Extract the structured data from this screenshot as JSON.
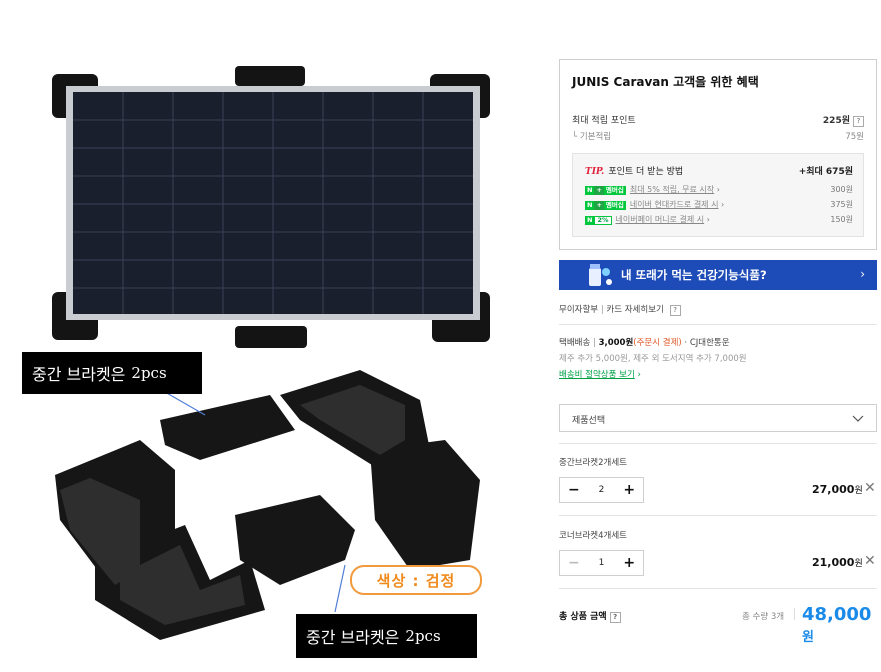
{
  "image": {
    "callout_top": {
      "text": "중간 브라켓은",
      "pcs": "2pcs"
    },
    "callout_bottom": {
      "text": "중간 브라켓은",
      "pcs": "2pcs"
    },
    "color_tag": "색상 : 검정"
  },
  "benefit": {
    "title": "JUNIS Caravan 고객을 위한 혜택",
    "max_points_label": "최대 적립 포인트",
    "max_points_value": "225원",
    "basic_label": "기본적립",
    "basic_value": "75원",
    "tip_word": "TIP.",
    "tip_label": "포인트 더 받는 방법",
    "tip_max": "+최대 675원",
    "tip_items": [
      {
        "badge": "멤버십",
        "label": "최대 5% 적립, 무료 시작",
        "value": "300원"
      },
      {
        "badge": "멤버십",
        "label": "네이버 현대카드로 결제 시",
        "value": "375원"
      },
      {
        "badge": "2%",
        "label": "네이버페이 머니로 결제 시",
        "value": "150원"
      }
    ]
  },
  "banner": {
    "text": "내 또래가 먹는 건강기능식품?",
    "arrow": "›"
  },
  "payment": {
    "installment": "무이자할부",
    "card_details": "카드 자세히보기"
  },
  "shipping": {
    "method": "택배배송",
    "fee": "3,000원",
    "fee_note": "(주문시 결제)",
    "carrier": "· CJ대한통운",
    "extra": "제주 추가 5,000원, 제주 외 도서지역 추가 7,000원",
    "bundle_link": "배송비 절약상품 보기"
  },
  "select": {
    "placeholder": "제품선택"
  },
  "options": [
    {
      "name": "중간브라켓2개세트",
      "qty": "2",
      "price": "27,000",
      "unit": "원"
    },
    {
      "name": "코너브라켓4개세트",
      "qty": "1",
      "price": "21,000",
      "unit": "원"
    }
  ],
  "total": {
    "label": "총 상품 금액",
    "qty_text": "총 수량 3개",
    "amount": "48,000",
    "unit": "원"
  },
  "colors": {
    "banner": "#1d4bb8",
    "price": "#1a8be8",
    "tip": "#e0223b",
    "naver_green": "#00c73c"
  }
}
